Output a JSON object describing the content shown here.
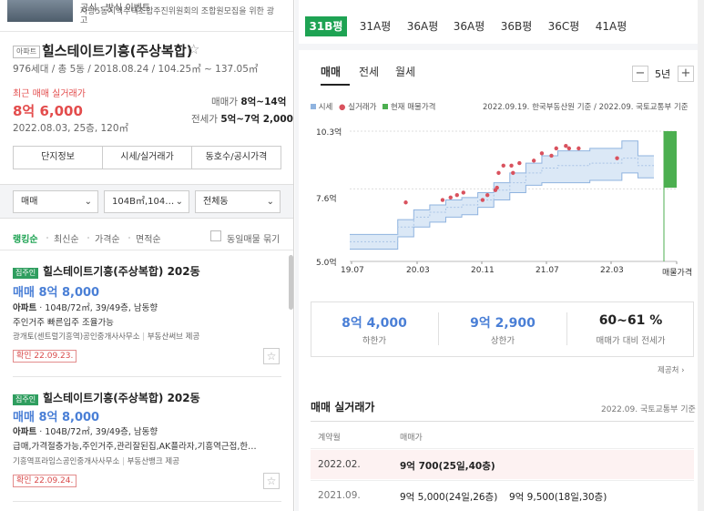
{
  "ad": {
    "title": "공식 · 방식 이벤트",
    "subtitle": "사랑5동지역주택조합주진위원회의 조합원모집을 위한 광고"
  },
  "complex": {
    "type_tag": "아파트",
    "name": "힐스테이트기흥(주상복합)",
    "meta": "976세대 / 총 5동 / 2018.08.24 / 104.25㎡ ~ 137.05㎡",
    "recent_label": "최근 매매 실거래가",
    "recent_price": "8억 6,000",
    "recent_detail": "2022.08.03, 25층, 120㎡",
    "sale_label": "매매가",
    "sale_range": "8억~14억",
    "jeonse_label": "전세가",
    "jeonse_range": "5억~7억 2,000"
  },
  "info_buttons": [
    "단지정보",
    "시세/실거래가",
    "동호수/공시가격"
  ],
  "filters": {
    "trade": "매매",
    "area": "104B㎡,104…",
    "dong": "전체동"
  },
  "sort_options": [
    "랭킹순",
    "최신순",
    "가격순",
    "면적순"
  ],
  "same_listing_label": "동일매물 묶기",
  "listings": [
    {
      "badge": "집주인",
      "name": "힐스테이트기흥(주상복합) 202동",
      "price": "매매 8억 8,000",
      "type": "아파트",
      "spec": " · 104B/72㎡, 39/49층, 남동향",
      "desc": "주인거주 빠른입주 조율가능",
      "agent": "광개토(센트럴기흥역)공인중개사사무소",
      "provider": "부동산써브 제공",
      "confirm": "확인 22.09.23."
    },
    {
      "badge": "집주인",
      "name": "힐스테이트기흥(주상복합) 202동",
      "price": "매매 8억 8,000",
      "type": "아파트",
      "spec": " · 104B/72㎡, 39/49층, 남동향",
      "desc": "급매,가격절충가능,주인거주,관리잘된집,AK플라자,기흥역근접,한…",
      "agent": "기흥역프라임스공인중개사사무소",
      "provider": "부동산뱅크 제공",
      "confirm": "확인 22.09.24."
    }
  ],
  "pyeong_tabs": [
    "31B평",
    "31A평",
    "36A평",
    "36A평",
    "36B평",
    "36C평",
    "41A평"
  ],
  "chart_tabs": [
    "매매",
    "전세",
    "월세"
  ],
  "period": "5년",
  "period_minus": "−",
  "period_plus": "+",
  "legend": {
    "market": "시세",
    "actual": "실거래가",
    "current": "현재 매물가격",
    "source": "2022.09.19. 한국부동산원 기준 / 2022.09. 국토교통부 기준"
  },
  "colors": {
    "accent_green": "#1ea353",
    "band_blue": "#dbe8f6",
    "line_blue": "#8fb3df",
    "dot_red": "#d9525e",
    "current_green": "#4caf50"
  },
  "chart_data": {
    "type": "area",
    "yticks": [
      "10.3억",
      "7.6억",
      "5.0억"
    ],
    "xticks": [
      "19.07",
      "20.03",
      "20.11",
      "21.07",
      "22.03",
      "매물가격"
    ],
    "ylim": [
      5.0,
      10.3
    ],
    "market_band": {
      "x": [
        0,
        1,
        2,
        3,
        4,
        5,
        6,
        7,
        8,
        9,
        10,
        11,
        12,
        13,
        14,
        15,
        16,
        17,
        18,
        19
      ],
      "low": [
        5.5,
        5.5,
        5.5,
        6.0,
        6.4,
        6.6,
        6.8,
        6.9,
        7.2,
        7.5,
        7.8,
        8.1,
        8.2,
        8.2,
        8.2,
        8.3,
        8.3,
        8.6,
        8.4,
        8.4
      ],
      "high": [
        6.1,
        6.1,
        6.1,
        6.7,
        7.1,
        7.3,
        7.5,
        7.6,
        7.8,
        8.2,
        8.6,
        9.0,
        9.3,
        9.5,
        9.5,
        9.6,
        9.6,
        9.9,
        9.3,
        9.3
      ],
      "mid": [
        5.8,
        5.8,
        5.8,
        6.4,
        6.8,
        7.0,
        7.2,
        7.3,
        7.5,
        7.9,
        8.2,
        8.6,
        8.8,
        8.9,
        8.9,
        9.0,
        9.0,
        9.2,
        8.9,
        8.9
      ]
    },
    "actual_points": [
      [
        3.5,
        7.4
      ],
      [
        5.8,
        7.5
      ],
      [
        6.3,
        7.6
      ],
      [
        6.7,
        7.7
      ],
      [
        7.1,
        7.8
      ],
      [
        8.3,
        7.5
      ],
      [
        8.6,
        7.7
      ],
      [
        9.1,
        7.9
      ],
      [
        9.2,
        8.0
      ],
      [
        9.3,
        8.6
      ],
      [
        9.6,
        8.9
      ],
      [
        10.2,
        8.6
      ],
      [
        11.5,
        9.1
      ],
      [
        12.0,
        9.4
      ],
      [
        12.6,
        9.3
      ],
      [
        12.9,
        9.6
      ],
      [
        13.5,
        9.7
      ],
      [
        13.7,
        9.6
      ],
      [
        14.3,
        9.6
      ],
      [
        16.7,
        9.2
      ],
      [
        10.6,
        9.0
      ],
      [
        10.1,
        8.9
      ]
    ],
    "current_range": [
      8.0,
      10.3
    ]
  },
  "stats": [
    {
      "value": "8억 4,000",
      "label": "하한가"
    },
    {
      "value": "9억 2,900",
      "label": "상한가"
    },
    {
      "value": "60~61 %",
      "label": "매매가 대비 전세가"
    }
  ],
  "provider_note": "제공처 ›",
  "trade_table": {
    "title": "매매 실거래가",
    "basis": "2022.09. 국토교통부 기준",
    "col_date": "계약월",
    "col_price": "매매가",
    "rows": [
      {
        "date": "2022.02.",
        "prices": [
          "9억 700(25일,40층)"
        ]
      },
      {
        "date": "2021.09.",
        "prices": [
          "9억 5,000(24일,26층)",
          "9억 9,500(18일,30층)"
        ]
      }
    ]
  }
}
